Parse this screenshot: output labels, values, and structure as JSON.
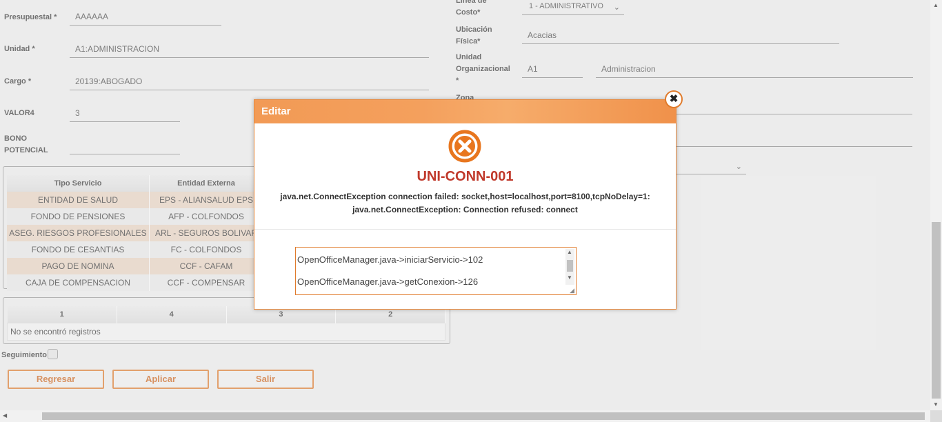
{
  "form_left": {
    "presupuestal": {
      "label": "Presupuestal",
      "req": "*",
      "value": "AAAAAA"
    },
    "unidad": {
      "label": "Unidad",
      "req": "*",
      "value": "A1:ADMINISTRACION"
    },
    "cargo": {
      "label": "Cargo",
      "req": "*",
      "value": "20139:ABOGADO"
    },
    "valor4": {
      "label": "VALOR4",
      "value": "3"
    },
    "bono_line1": "BONO",
    "bono_line2": "POTENCIAL",
    "bono_value": ""
  },
  "form_right": {
    "linea_line1": "Línea de",
    "linea_line2": "Costo*",
    "linea_value": "1 - ADMINISTRATIVO",
    "ubicacion_line1": "Ubicación",
    "ubicacion_line2": "Física*",
    "ubicacion_value": "Acacias",
    "unidad_org_line1": "Unidad",
    "unidad_org_line2": "Organizacional",
    "unidad_org_line3": "*",
    "unidad_org_code": "A1",
    "unidad_org_name": "Administracion",
    "zona_label": "Zona"
  },
  "services_table": {
    "headers": [
      "Tipo Servicio",
      "Entidad Externa"
    ],
    "rows": [
      [
        "ENTIDAD DE SALUD",
        "EPS - ALIANSALUD EPS"
      ],
      [
        "FONDO DE PENSIONES",
        "AFP - COLFONDOS"
      ],
      [
        "ASEG. RIESGOS PROFESIONALES",
        "ARL - SEGUROS BOLIVAR"
      ],
      [
        "FONDO DE CESANTIAS",
        "FC - COLFONDOS"
      ],
      [
        "PAGO DE NOMINA",
        "CCF - CAFAM"
      ],
      [
        "CAJA DE COMPENSACION",
        "CCF - COMPENSAR"
      ]
    ]
  },
  "second_table": {
    "headers": [
      "1",
      "4",
      "3",
      "2"
    ],
    "empty_text": "No se encontró registros"
  },
  "seguimiento_label": "Seguimiento",
  "buttons": {
    "regresar": "Regresar",
    "aplicar": "Aplicar",
    "salir": "Salir"
  },
  "modal": {
    "title": "Editar",
    "close_glyph": "✖",
    "error_code": "UNI-CONN-001",
    "message_line1": "java.net.ConnectException connection failed: socket,host=localhost,port=8100,tcpNoDelay=1:",
    "message_line2": "java.net.ConnectException: Connection refused: connect",
    "stack_line1": "OpenOfficeManager.java->iniciarServicio->102",
    "stack_line2": "OpenOfficeManager.java->getConexion->126"
  },
  "colors": {
    "accent": "#e07b2c",
    "error_red": "#c0392b",
    "row_alt": "#ecd6c4"
  }
}
